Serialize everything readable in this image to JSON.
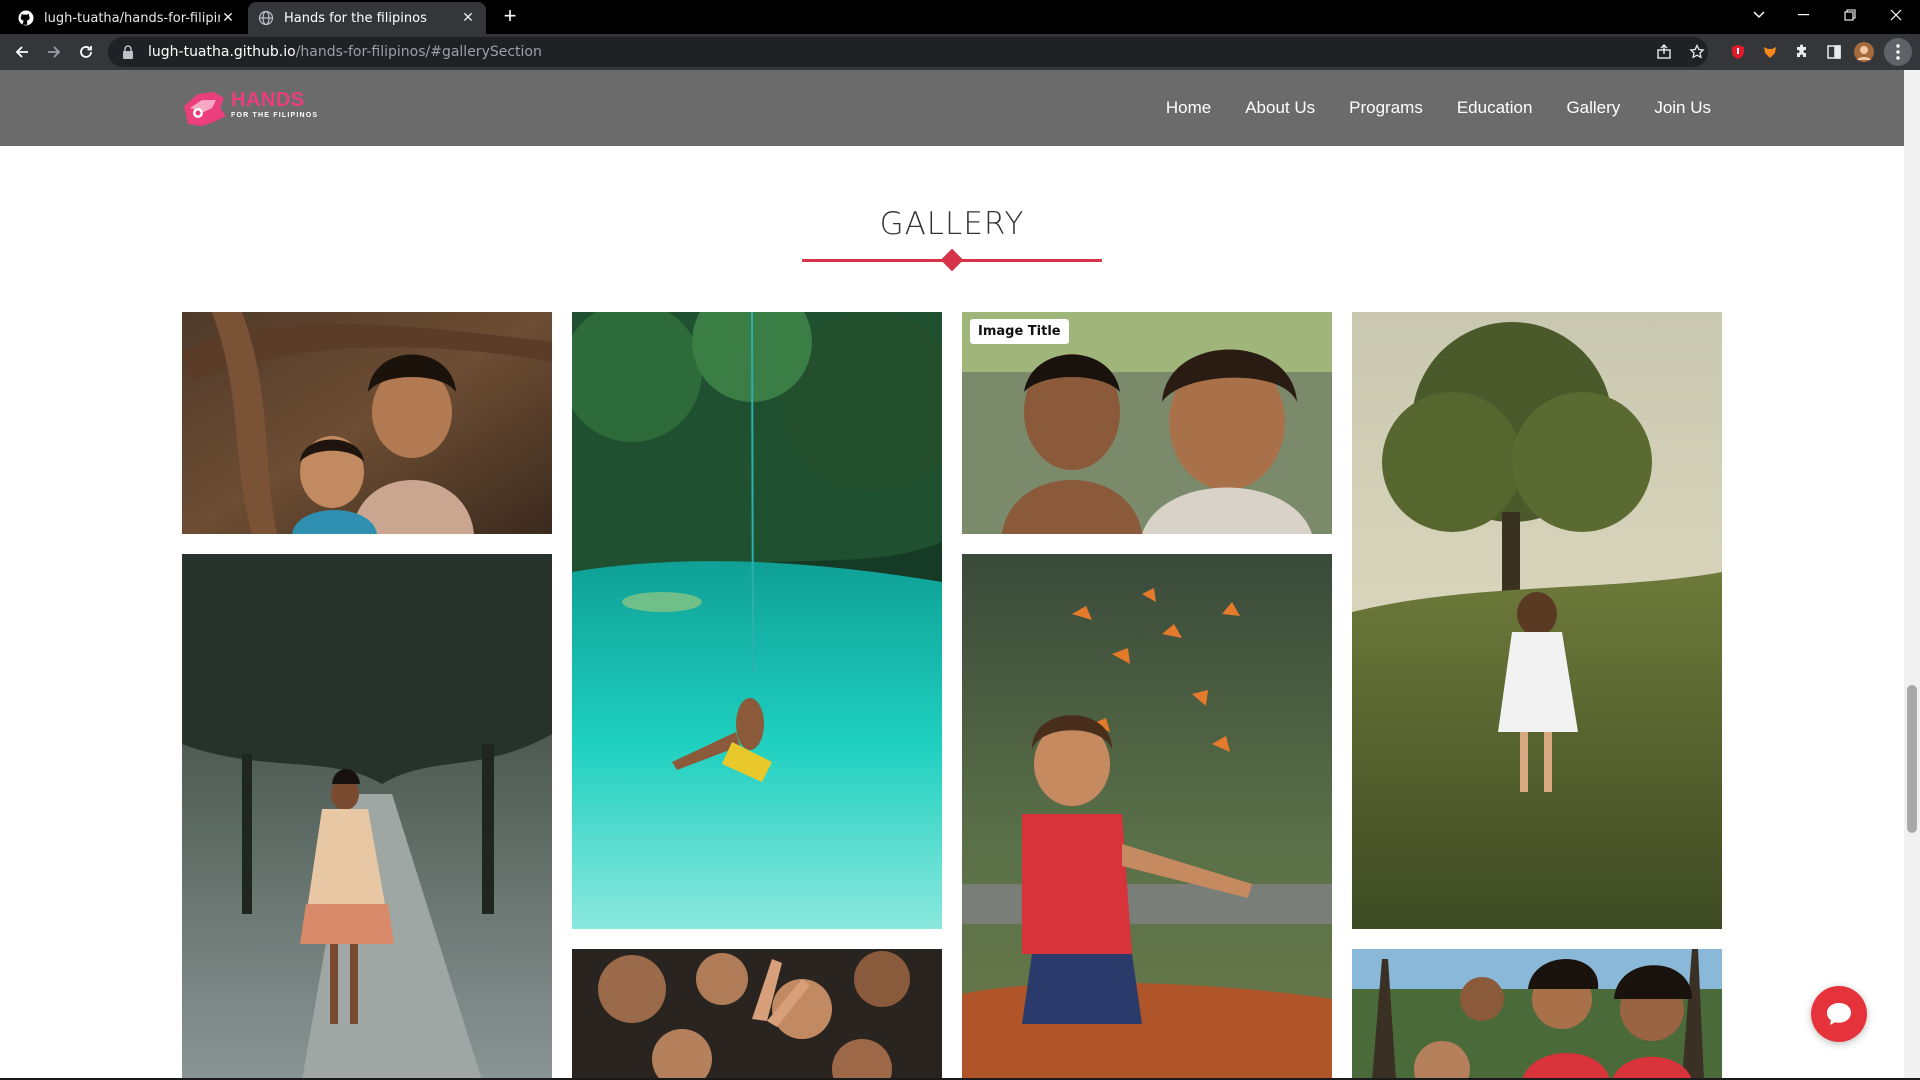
{
  "browser": {
    "tabs": [
      {
        "title": "lugh-tuatha/hands-for-filipinos",
        "icon": "github-icon",
        "active": false
      },
      {
        "title": "Hands for the filipinos",
        "icon": "globe-icon",
        "active": true
      }
    ],
    "url_host": "lugh-tuatha.github.io",
    "url_path": "/hands-for-filipinos/#gallerySection"
  },
  "site": {
    "logo": {
      "word": "HANDS",
      "sub": "FOR THE FILIPINOS"
    },
    "nav": [
      "Home",
      "About Us",
      "Programs",
      "Education",
      "Gallery",
      "Join Us"
    ]
  },
  "gallery": {
    "title": "GALLERY",
    "badge": "Image Title",
    "accent_color": "#d7344a"
  },
  "chat": {
    "icon": "chat-bubble-icon",
    "color": "#e6333b"
  }
}
